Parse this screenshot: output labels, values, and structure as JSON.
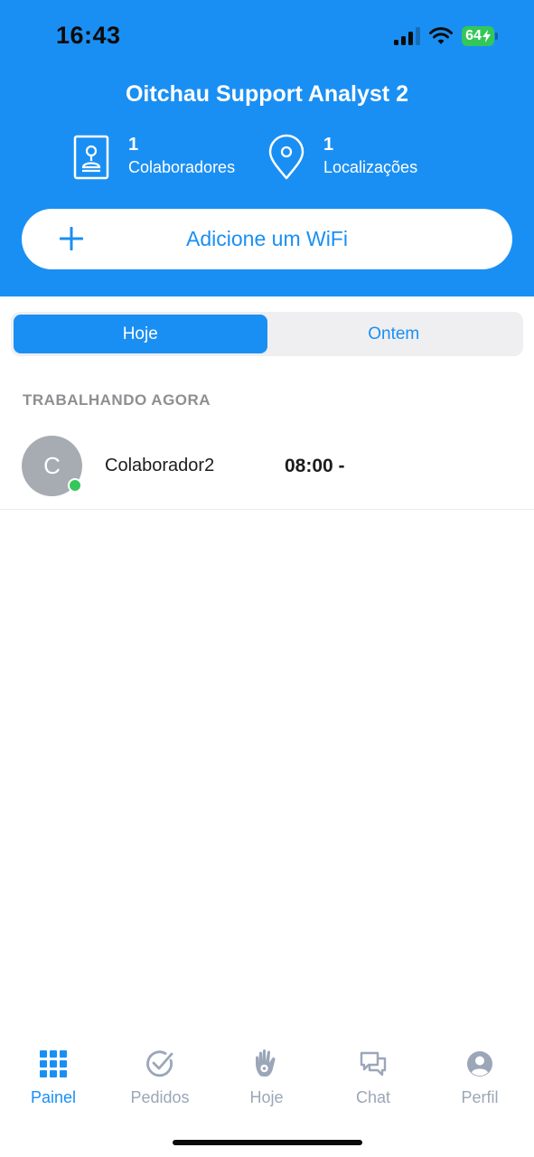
{
  "status_bar": {
    "time": "16:43",
    "battery": "64",
    "signal_icon": "cellular-signal-icon",
    "wifi_icon": "wifi-icon",
    "charging_icon": "bolt-icon"
  },
  "header": {
    "company_name": "Oitchau Support Analyst 2",
    "collaborators": {
      "count": "1",
      "label": "Colaboradores",
      "icon": "id-badge-icon"
    },
    "locations": {
      "count": "1",
      "label": "Localizações",
      "icon": "location-pin-icon"
    },
    "add_wifi": {
      "label": "Adicione um WiFi",
      "icon": "plus-icon"
    }
  },
  "segments": [
    {
      "label": "Hoje",
      "active": true
    },
    {
      "label": "Ontem",
      "active": false
    }
  ],
  "working_now": {
    "section_title": "TRABALHANDO AGORA",
    "rows": [
      {
        "initial": "C",
        "name": "Colaborador2",
        "time": "08:00 -",
        "online": true
      }
    ]
  },
  "tabbar": [
    {
      "label": "Painel",
      "icon": "grid-icon",
      "active": true
    },
    {
      "label": "Pedidos",
      "icon": "check-circle-icon",
      "active": false
    },
    {
      "label": "Hoje",
      "icon": "hand-icon",
      "active": false
    },
    {
      "label": "Chat",
      "icon": "chat-bubbles-icon",
      "active": false
    },
    {
      "label": "Perfil",
      "icon": "profile-icon",
      "active": false
    }
  ],
  "colors": {
    "primary": "#1a8ff3",
    "online": "#35c759",
    "tab_inactive": "#9ba6b8",
    "avatar": "#a7abb2"
  }
}
